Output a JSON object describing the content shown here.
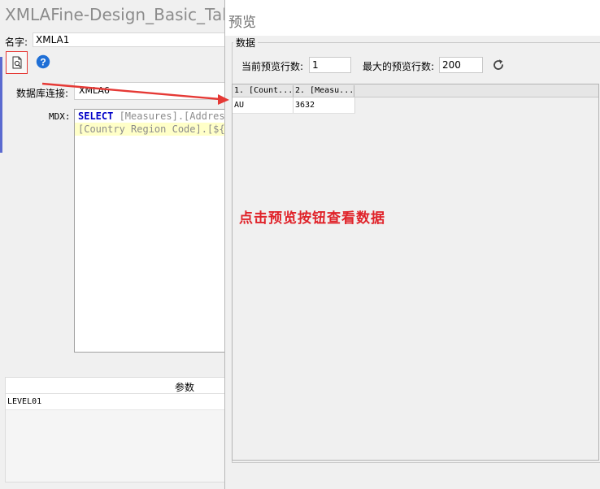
{
  "main_window": {
    "title": "XMLAFine-Design_Basic_TableD",
    "name_label": "名字:",
    "name_value": "XMLA1",
    "db_label": "数据库连接:",
    "db_value": "XMLA6",
    "mdx_label": "MDX:",
    "mdx_line1_keyword": "SELECT",
    "mdx_line1_rest": " [Measures].[Address",
    "mdx_line2": "[Country Region Code].[${L",
    "params_header": "参数",
    "params_row": "LEVEL01"
  },
  "toolbar": {
    "preview_icon": "preview-document-icon",
    "help_icon": "help-icon"
  },
  "preview_dialog": {
    "title": "预览",
    "group_label": "数据",
    "current_rows_label": "当前预览行数:",
    "current_rows_value": "1",
    "max_rows_label": "最大的预览行数:",
    "max_rows_value": "200",
    "refresh_icon": "refresh-icon",
    "columns": [
      "1. [Count...",
      "2. [Measu..."
    ],
    "rows": [
      [
        "AU",
        "3632"
      ]
    ]
  },
  "annotation": {
    "text": "点击预览按钮查看数据",
    "color": "#e0232a"
  }
}
